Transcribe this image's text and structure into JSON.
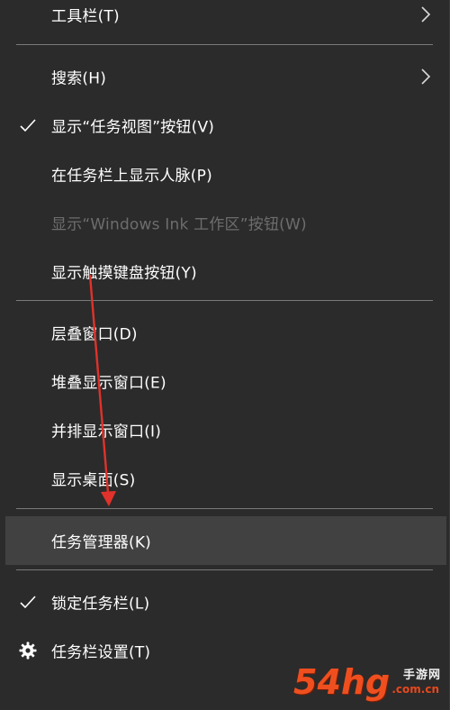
{
  "menu": {
    "items": [
      {
        "label": "工具栏(T)",
        "checked": false,
        "submenu": true,
        "disabled": false,
        "icon": "none"
      },
      {
        "label": "搜索(H)",
        "checked": false,
        "submenu": true,
        "disabled": false,
        "icon": "none"
      },
      {
        "label": "显示“任务视图”按钮(V)",
        "checked": true,
        "submenu": false,
        "disabled": false,
        "icon": "check-icon"
      },
      {
        "label": "在任务栏上显示人脉(P)",
        "checked": false,
        "submenu": false,
        "disabled": false,
        "icon": "none"
      },
      {
        "label": "显示“Windows Ink 工作区”按钮(W)",
        "checked": false,
        "submenu": false,
        "disabled": true,
        "icon": "none"
      },
      {
        "label": "显示触摸键盘按钮(Y)",
        "checked": false,
        "submenu": false,
        "disabled": false,
        "icon": "none"
      },
      {
        "label": "层叠窗口(D)",
        "checked": false,
        "submenu": false,
        "disabled": false,
        "icon": "none"
      },
      {
        "label": "堆叠显示窗口(E)",
        "checked": false,
        "submenu": false,
        "disabled": false,
        "icon": "none"
      },
      {
        "label": "并排显示窗口(I)",
        "checked": false,
        "submenu": false,
        "disabled": false,
        "icon": "none"
      },
      {
        "label": "显示桌面(S)",
        "checked": false,
        "submenu": false,
        "disabled": false,
        "icon": "none"
      },
      {
        "label": "任务管理器(K)",
        "checked": false,
        "submenu": false,
        "disabled": false,
        "highlighted": true,
        "icon": "none"
      },
      {
        "label": "锁定任务栏(L)",
        "checked": true,
        "submenu": false,
        "disabled": false,
        "icon": "check-icon"
      },
      {
        "label": "任务栏设置(T)",
        "checked": false,
        "submenu": false,
        "disabled": false,
        "icon": "gear-icon"
      }
    ]
  },
  "annotation": {
    "type": "red-arrow",
    "color": "#e0322b",
    "points_to": "任务管理器(K)"
  },
  "watermark": {
    "digits": "54hg",
    "text": "手游网",
    "sub": ".com.cn",
    "color": "#ef4f1f"
  },
  "colors": {
    "background": "#2b2b2b",
    "highlight": "#414141",
    "text": "#ffffff",
    "disabled_text": "#6d6d6d",
    "separator": "#7a7a7a"
  }
}
